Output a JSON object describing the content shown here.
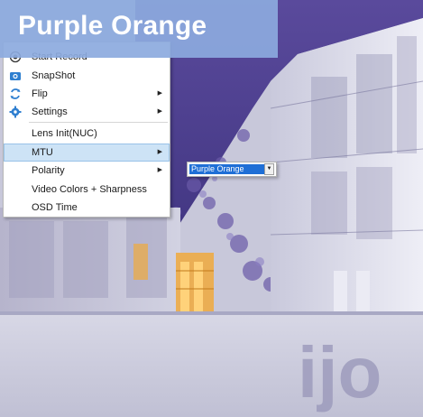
{
  "title_banner": {
    "text": "Purple Orange"
  },
  "menu": {
    "items": [
      {
        "label": "Start Record",
        "icon": "record-icon",
        "has_submenu": false
      },
      {
        "label": "SnapShot",
        "icon": "camera-icon",
        "has_submenu": false
      },
      {
        "label": "Flip",
        "icon": "flip-icon",
        "has_submenu": true
      },
      {
        "label": "Settings",
        "icon": "gear-icon",
        "has_submenu": true
      },
      {
        "label": "Lens Init(NUC)",
        "icon": "",
        "has_submenu": false
      },
      {
        "label": "MTU",
        "icon": "",
        "has_submenu": true,
        "highlighted": true
      },
      {
        "label": "Polarity",
        "icon": "",
        "has_submenu": true
      },
      {
        "label": "Video Colors + Sharpness",
        "icon": "",
        "has_submenu": false
      },
      {
        "label": "OSD Time",
        "icon": "",
        "has_submenu": false
      }
    ],
    "submenu_arrow": "▶"
  },
  "palette_select": {
    "selected": "Purple Orange",
    "dropdown_arrow": "▼"
  },
  "scene": {
    "sky_color": "#4b3d8e",
    "building_color": "#dcdcea",
    "hot_color": "#f0a93c",
    "sign_text": "ijo"
  },
  "colors": {
    "banner_bg": "#8caade",
    "menu_highlight": "#cde3f6",
    "select_highlight": "#1f6fd6"
  }
}
